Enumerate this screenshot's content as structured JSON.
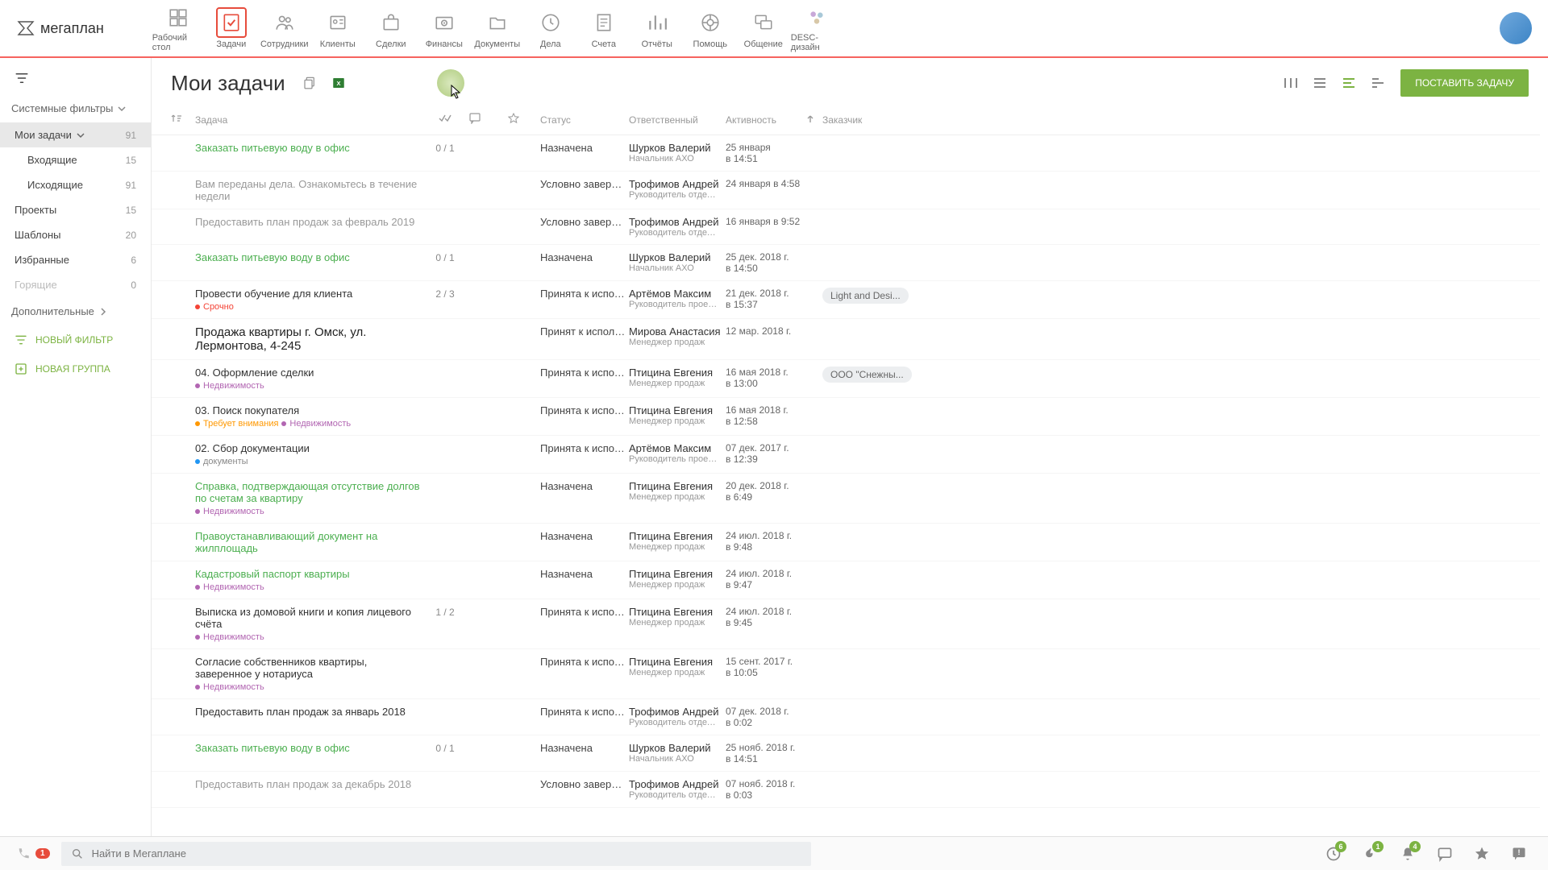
{
  "brand": "мегаплан",
  "nav": [
    "Рабочий стол",
    "Задачи",
    "Сотрудники",
    "Клиенты",
    "Сделки",
    "Финансы",
    "Документы",
    "Дела",
    "Счета",
    "Отчёты",
    "Помощь",
    "Общение",
    "DESC-дизайн"
  ],
  "sidebar": {
    "systemFilters": "Системные фильтры",
    "items": [
      {
        "label": "Мои задачи",
        "count": "91",
        "active": true,
        "expand": true
      },
      {
        "label": "Входящие",
        "count": "15",
        "indent": true
      },
      {
        "label": "Исходящие",
        "count": "91",
        "indent": true
      },
      {
        "label": "Проекты",
        "count": "15"
      },
      {
        "label": "Шаблоны",
        "count": "20"
      },
      {
        "label": "Избранные",
        "count": "6"
      },
      {
        "label": "Горящие",
        "count": "0",
        "muted": true
      }
    ],
    "additional": "Дополнительные",
    "newFilter": "НОВЫЙ ФИЛЬТР",
    "newGroup": "НОВАЯ ГРУППА"
  },
  "pageTitle": "Мои задачи",
  "createBtn": "ПОСТАВИТЬ ЗАДАЧУ",
  "headers": {
    "task": "Задача",
    "status": "Статус",
    "responsible": "Ответственный",
    "activity": "Активность",
    "customer": "Заказчик"
  },
  "rows": [
    {
      "title": "Заказать питьевую воду в офис",
      "cls": "green",
      "prog": "0 / 1",
      "status": "Назначена",
      "resp": "Шурков Валерий",
      "role": "Начальник АХО",
      "act1": "25 января",
      "act2": "в 14:51"
    },
    {
      "title": "Вам переданы дела. Ознакомьтесь в течение недели",
      "cls": "muted",
      "status": "Условно заверше...",
      "resp": "Трофимов Андрей",
      "role": "Руководитель отдела п...",
      "act1": "24 января в 4:58"
    },
    {
      "title": "Предоставить план продаж за февраль 2019",
      "cls": "muted",
      "status": "Условно заверше...",
      "resp": "Трофимов Андрей",
      "role": "Руководитель отдела п...",
      "act1": "16 января в 9:52"
    },
    {
      "title": "Заказать питьевую воду в офис",
      "cls": "green",
      "prog": "0 / 1",
      "status": "Назначена",
      "resp": "Шурков Валерий",
      "role": "Начальник АХО",
      "act1": "25 дек. 2018 г.",
      "act2": "в 14:50"
    },
    {
      "title": "Провести обучение для клиента",
      "sub": {
        "dot": "red",
        "txt": "Срочно",
        "tcls": "t-red"
      },
      "prog": "2 / 3",
      "status": "Принята к испол...",
      "resp": "Артёмов Максим",
      "role": "Руководитель проектов",
      "act1": "21 дек. 2018 г.",
      "act2": "в 15:37",
      "chip": "Light and Desi..."
    },
    {
      "title": "Продажа квартиры г. Омск, ул. Лермонтова, 4-245",
      "cls": "bold",
      "status": "Принят к исполне...",
      "resp": "Мирова Анастасия",
      "role": "Менеджер продаж",
      "act1": "12 мар. 2018 г."
    },
    {
      "title": "04. Оформление сделки",
      "sub": {
        "dot": "purple",
        "txt": "Недвижимость",
        "tcls": "t-purple"
      },
      "status": "Принята к испол...",
      "resp": "Птицина Евгения",
      "role": "Менеджер продаж",
      "act1": "16 мая 2018 г.",
      "act2": "в 13:00",
      "chip": "ООО \"Снежны..."
    },
    {
      "title": "03. Поиск покупателя",
      "sub": {
        "dot": "orange",
        "txt": "Требует внимания",
        "tcls": "t-orange",
        "dot2": "purple",
        "txt2": "Недвижимость",
        "tcls2": "t-purple"
      },
      "status": "Принята к испол...",
      "resp": "Птицина Евгения",
      "role": "Менеджер продаж",
      "act1": "16 мая 2018 г.",
      "act2": "в 12:58"
    },
    {
      "title": "02. Сбор документации",
      "sub": {
        "dot": "blue",
        "txt": "документы",
        "tcls": "t-grey"
      },
      "status": "Принята к испол...",
      "resp": "Артёмов Максим",
      "role": "Руководитель проектов",
      "act1": "07 дек. 2017 г.",
      "act2": "в 12:39"
    },
    {
      "title": "Справка, подтверждающая отсутствие долгов по счетам за квартиру",
      "cls": "green",
      "sub": {
        "dot": "purple",
        "txt": "Недвижимость",
        "tcls": "t-purple"
      },
      "status": "Назначена",
      "resp": "Птицина Евгения",
      "role": "Менеджер продаж",
      "act1": "20 дек. 2018 г.",
      "act2": "в 6:49"
    },
    {
      "title": "Правоустанавливающий документ на жилплощадь",
      "cls": "green",
      "status": "Назначена",
      "resp": "Птицина Евгения",
      "role": "Менеджер продаж",
      "act1": "24 июл. 2018 г.",
      "act2": "в 9:48"
    },
    {
      "title": "Кадастровый паспорт квартиры",
      "cls": "green",
      "sub": {
        "dot": "purple",
        "txt": "Недвижимость",
        "tcls": "t-purple"
      },
      "status": "Назначена",
      "resp": "Птицина Евгения",
      "role": "Менеджер продаж",
      "act1": "24 июл. 2018 г.",
      "act2": "в 9:47"
    },
    {
      "title": "Выписка из домовой книги и копия лицевого счёта",
      "sub": {
        "dot": "purple",
        "txt": "Недвижимость",
        "tcls": "t-purple"
      },
      "prog": "1 / 2",
      "status": "Принята к испол...",
      "resp": "Птицина Евгения",
      "role": "Менеджер продаж",
      "act1": "24 июл. 2018 г.",
      "act2": "в 9:45"
    },
    {
      "title": "Согласие собственников квартиры, заверенное у нотариуса",
      "sub": {
        "dot": "purple",
        "txt": "Недвижимость",
        "tcls": "t-purple"
      },
      "status": "Принята к испол...",
      "resp": "Птицина Евгения",
      "role": "Менеджер продаж",
      "act1": "15 сент. 2017 г.",
      "act2": "в 10:05"
    },
    {
      "title": "Предоставить план продаж за январь 2018",
      "status": "Принята к испол...",
      "resp": "Трофимов Андрей",
      "role": "Руководитель отдела п...",
      "act1": "07 дек. 2018 г.",
      "act2": "в 0:02"
    },
    {
      "title": "Заказать питьевую воду в офис",
      "cls": "green",
      "prog": "0 / 1",
      "status": "Назначена",
      "resp": "Шурков Валерий",
      "role": "Начальник АХО",
      "act1": "25 нояб. 2018 г.",
      "act2": "в 14:51"
    },
    {
      "title": "Предоставить план продаж за декабрь 2018",
      "cls": "muted",
      "status": "Условно заверше...",
      "resp": "Трофимов Андрей",
      "role": "Руководитель отдела п...",
      "act1": "07 нояб. 2018 г.",
      "act2": "в 0:03"
    }
  ],
  "search": {
    "placeholder": "Найти в Мегаплане"
  },
  "bottom": {
    "phone": "1",
    "b1": "6",
    "b2": "1",
    "b3": "4"
  }
}
